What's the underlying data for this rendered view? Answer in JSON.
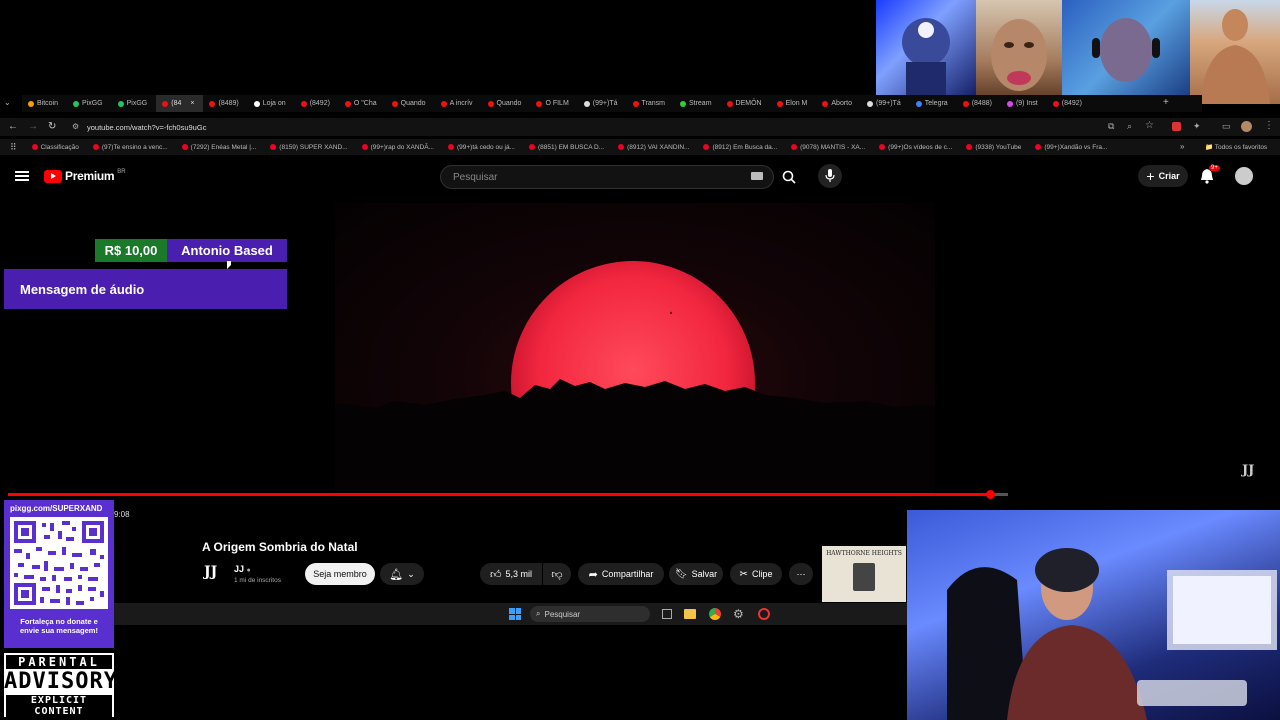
{
  "browser": {
    "tabs": [
      {
        "label": "Bitcoin",
        "color": "#f59e0b"
      },
      {
        "label": "PixGG",
        "color": "#22c55e"
      },
      {
        "label": "PixGG",
        "color": "#22c55e"
      },
      {
        "label": "(84",
        "color": "#e11"
      },
      {
        "label": "(8489)",
        "color": "#e11"
      },
      {
        "label": "Loja on",
        "color": "#fff"
      },
      {
        "label": "(8492)",
        "color": "#e11"
      },
      {
        "label": "O \"Cha",
        "color": "#e11"
      },
      {
        "label": "Quando",
        "color": "#e11"
      },
      {
        "label": "A incrív",
        "color": "#e11"
      },
      {
        "label": "Quando",
        "color": "#e11"
      },
      {
        "label": "O FILM",
        "color": "#e11"
      },
      {
        "label": "(99+)Tá",
        "color": "#ddd"
      },
      {
        "label": "Transm",
        "color": "#e11"
      },
      {
        "label": "Stream",
        "color": "#2ecc40"
      },
      {
        "label": "DEMÔN",
        "color": "#e11"
      },
      {
        "label": "Elon M",
        "color": "#e11"
      },
      {
        "label": "Aborto",
        "color": "#e11"
      },
      {
        "label": "(99+)Tá",
        "color": "#ddd"
      },
      {
        "label": "Telegra",
        "color": "#3b82f6"
      },
      {
        "label": "(8488)",
        "color": "#e11"
      },
      {
        "label": "(9) Inst",
        "color": "#d946ef"
      },
      {
        "label": "(8492)",
        "color": "#e11"
      }
    ],
    "address": "youtube.com/watch?v=-fch0su9uGc",
    "bookmarks": [
      "Classificação",
      "(97)Te ensino a venc...",
      "(7292) Enéas Metal |...",
      "(8159) SUPER XAND...",
      "(99+)rap do XANDÃ...",
      "(99+)tá cedo ou já...",
      "(8851) EM BUSCA D...",
      "(8912) VAI XANDIN...",
      "(8912) Em Busca da...",
      "(9078) MANTIS - XA...",
      "(99+)Os vídeos de c...",
      "(9338) YouTube",
      "(99+)Xandão vs Fra..."
    ],
    "bookmarks_all": "Todos os favoritos"
  },
  "youtube": {
    "logo_text": "Premium",
    "logo_region": "BR",
    "search_placeholder": "Pesquisar",
    "create_label": "Criar",
    "notif_count": "9+",
    "video_title": "A Origem Sombria do Natal",
    "channel_name": "JJ",
    "subscribers": "1 mi de inscritos",
    "join_label": "Seja membro",
    "likes": "5,3 mil",
    "share_label": "Compartilhar",
    "save_label": "Salvar",
    "clip_label": "Clipe",
    "time_fragment": "9:08",
    "watermark": "JJ",
    "progress": 0.98,
    "suggestion_thumb_text": "HAWTHORNE HEIGHTS"
  },
  "donation": {
    "amount": "R$ 10,00",
    "name": "Antonio Based",
    "message": "Mensagem de áudio"
  },
  "overlay": {
    "pix_url": "pixgg.com/SUPERXAND",
    "qr_caption": "Fortaleça no donate e envie sua mensagem!",
    "advisory_top": "PARENTAL",
    "advisory_mid": "ADVISORY",
    "advisory_bottom": "EXPLICIT CONTENT"
  },
  "taskbar": {
    "search_placeholder": "Pesquisar"
  },
  "colors": {
    "accent_red": "#ff0000",
    "donation_purple": "#4a1fb0",
    "donation_green": "#1a7a2a"
  }
}
